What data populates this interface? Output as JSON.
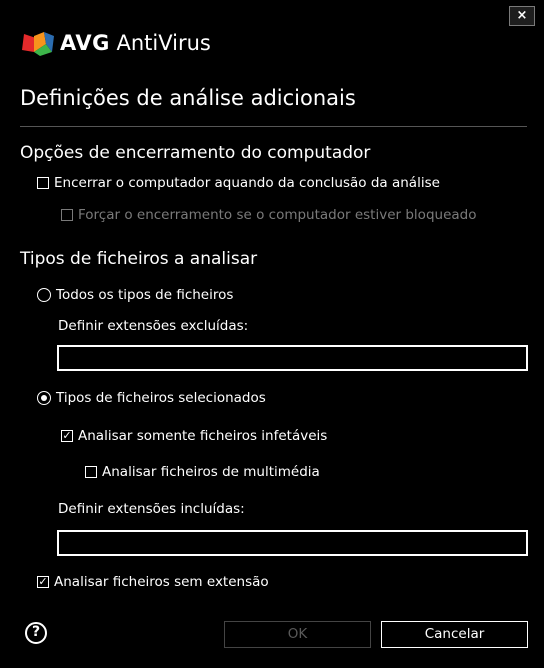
{
  "window": {
    "brand_bold": "AVG",
    "brand_rest": " AntiVirus",
    "close_label": "×"
  },
  "page_title": "Definições de análise adicionais",
  "shutdown_section": {
    "heading": "Opções de encerramento do computador",
    "shutdown_option": {
      "label": "Encerrar o computador aquando da conclusão da análise",
      "checked": false
    },
    "force_option": {
      "label": "Forçar o encerramento se o computador estiver bloqueado",
      "checked": false,
      "disabled": true
    }
  },
  "file_types_section": {
    "heading": "Tipos de ficheiros a analisar",
    "all_types": {
      "label": "Todos os tipos de ficheiros",
      "selected": false
    },
    "excluded_label": "Definir extensões excluídas:",
    "excluded_value": "",
    "selected_types": {
      "label": "Tipos de ficheiros selecionados",
      "selected": true
    },
    "infectable_only": {
      "label": "Analisar somente ficheiros infetáveis",
      "checked": true
    },
    "multimedia": {
      "label": "Analisar ficheiros de multimédia",
      "checked": false
    },
    "included_label": "Definir extensões incluídas:",
    "included_value": "",
    "no_extension": {
      "label": "Analisar ficheiros sem extensão",
      "checked": true
    }
  },
  "footer": {
    "help_glyph": "?",
    "ok_label": "OK",
    "cancel_label": "Cancelar"
  },
  "colors": {
    "background": "#000000",
    "text": "#ffffff",
    "disabled_text": "#7a7a7a",
    "logo_red": "#e52a2b",
    "logo_orange": "#f7941d",
    "logo_green": "#3db54a",
    "logo_blue": "#2b6cb0"
  }
}
